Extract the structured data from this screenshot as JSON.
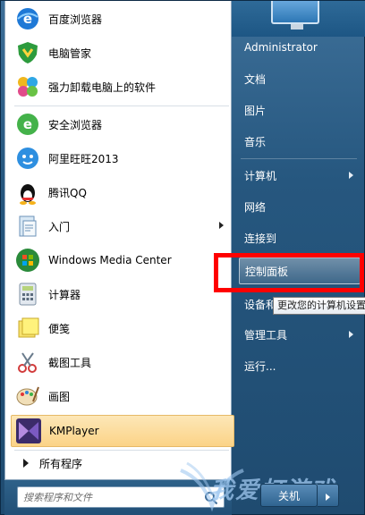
{
  "left_programs": [
    {
      "label": "百度浏览器",
      "icon": "baidu-browser-icon",
      "arrow": false
    },
    {
      "label": "电脑管家",
      "icon": "pc-manager-icon",
      "arrow": false
    },
    {
      "label": "强力卸载电脑上的软件",
      "icon": "uninstaller-icon",
      "arrow": false
    },
    {
      "label": "安全浏览器",
      "icon": "safe-browser-icon",
      "arrow": false
    },
    {
      "label": "阿里旺旺2013",
      "icon": "aliwangwang-icon",
      "arrow": false
    },
    {
      "label": "腾讯QQ",
      "icon": "qq-icon",
      "arrow": false
    },
    {
      "label": "入门",
      "icon": "getting-started-icon",
      "arrow": true
    },
    {
      "label": "Windows Media Center",
      "icon": "media-center-icon",
      "arrow": false
    },
    {
      "label": "计算器",
      "icon": "calculator-icon",
      "arrow": false
    },
    {
      "label": "便笺",
      "icon": "sticky-notes-icon",
      "arrow": false
    },
    {
      "label": "截图工具",
      "icon": "snipping-tool-icon",
      "arrow": false
    },
    {
      "label": "画图",
      "icon": "paint-icon",
      "arrow": false
    }
  ],
  "pinned_active": {
    "label": "KMPlayer",
    "icon": "kmplayer-icon"
  },
  "all_programs_label": "所有程序",
  "search": {
    "placeholder": "搜索程序和文件"
  },
  "right_items": [
    {
      "label": "Administrator",
      "arrow": false
    },
    {
      "label": "文档",
      "arrow": false
    },
    {
      "label": "图片",
      "arrow": false
    },
    {
      "label": "音乐",
      "arrow": false
    },
    {
      "label": "计算机",
      "arrow": true
    },
    {
      "label": "网络",
      "arrow": false
    },
    {
      "label": "连接到",
      "arrow": false
    },
    {
      "label": "控制面板",
      "arrow": false
    },
    {
      "label": "设备和",
      "arrow": false
    },
    {
      "label": "管理工具",
      "arrow": true
    },
    {
      "label": "运行...",
      "arrow": false
    }
  ],
  "tooltip": "更改您的计算机设置",
  "shutdown_label": "关机",
  "watermark_text": "我爱打游戏",
  "colors": {
    "highlight": "#ff0000",
    "kmplayer_bg": "#fbd387"
  }
}
